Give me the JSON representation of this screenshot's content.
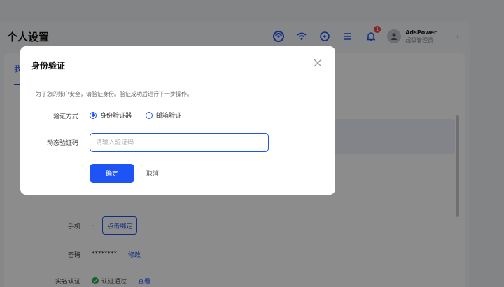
{
  "page": {
    "title": "个人设置"
  },
  "topbar": {
    "notification_badge": "1",
    "user": {
      "name": "AdsPower",
      "role": "超级管理员"
    }
  },
  "tabs": [
    {
      "label": "我"
    }
  ],
  "profile": {
    "phone": {
      "label": "手机",
      "value": "-",
      "action": "点击绑定"
    },
    "password": {
      "label": "密码",
      "value": "********",
      "action": "修改"
    },
    "realname": {
      "label": "实名认证",
      "value": "认证通过",
      "action": "查看"
    }
  },
  "modal": {
    "title": "身份验证",
    "hint": "为了您的账户安全，请验证身份。验证成功后进行下一步操作。",
    "method_label": "验证方式",
    "methods": [
      {
        "label": "身份验证器",
        "selected": true
      },
      {
        "label": "邮箱验证",
        "selected": false
      }
    ],
    "code_label": "动态验证码",
    "code_placeholder": "请输入验证码",
    "code_value": "",
    "confirm": "确定",
    "cancel": "取消"
  },
  "colors": {
    "accent": "#1e54f5",
    "success": "#27b24a",
    "badge": "#f04040",
    "overlay": "rgba(0,0,0,0.45)"
  }
}
